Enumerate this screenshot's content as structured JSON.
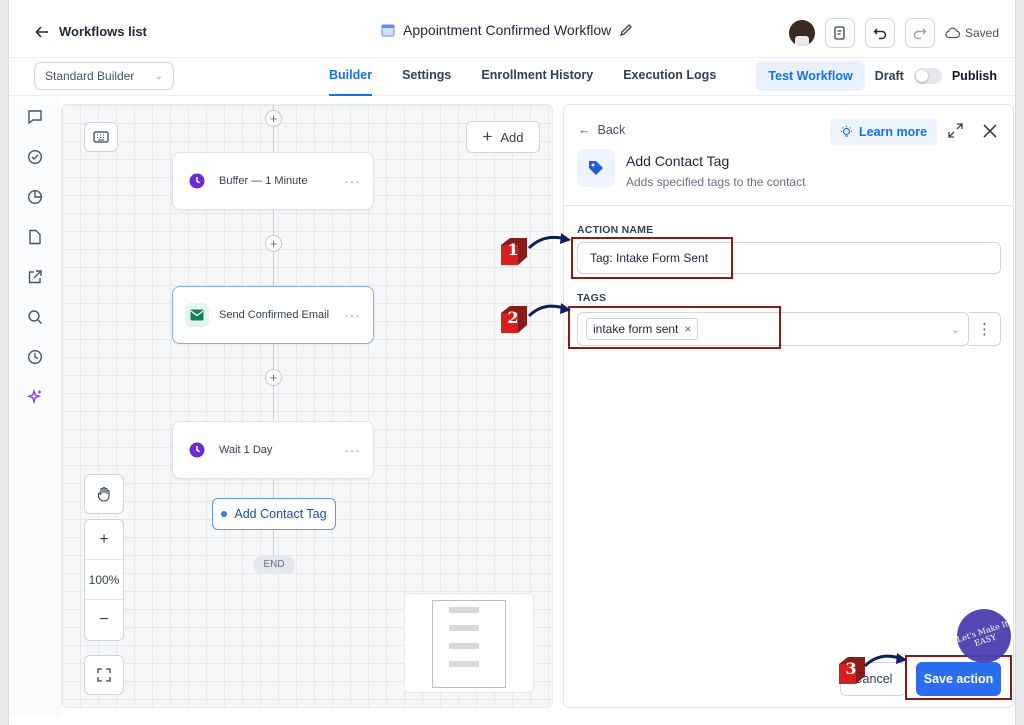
{
  "header": {
    "back_label": "Workflows list",
    "workflow_title": "Appointment Confirmed Workflow",
    "saved_label": "Saved"
  },
  "subbar": {
    "builder_select": "Standard Builder",
    "tabs": [
      {
        "label": "Builder",
        "active": true
      },
      {
        "label": "Settings",
        "active": false
      },
      {
        "label": "Enrollment History",
        "active": false
      },
      {
        "label": "Execution Logs",
        "active": false
      }
    ],
    "test_button": "Test Workflow",
    "draft_label": "Draft",
    "publish_label": "Publish"
  },
  "sidebar": {
    "icons": [
      "chat-icon",
      "check-circle-icon",
      "pie-chart-icon",
      "file-icon",
      "external-link-icon",
      "search-icon",
      "clock-icon",
      "sparkles-icon"
    ]
  },
  "canvas": {
    "add_button": "Add",
    "nodes": [
      {
        "label": "Buffer — 1 Minute",
        "icon": "clock-icon",
        "color": "#7c3aed"
      },
      {
        "label": "Send Confirmed Email",
        "icon": "mail-icon",
        "color": "#12805c"
      },
      {
        "label": "Wait 1 Day",
        "icon": "clock-icon",
        "color": "#7c3aed"
      }
    ],
    "new_action_label": "Add Contact Tag",
    "end_label": "END",
    "zoom_level": "100%"
  },
  "panel": {
    "back_label": "Back",
    "learn_more": "Learn more",
    "title": "Add Contact Tag",
    "description": "Adds specified tags to the contact",
    "action_name_label": "ACTION NAME",
    "action_name_value": "Tag: Intake Form Sent",
    "tags_label": "TAGS",
    "tag_chip": "intake form sent",
    "cancel_label": "Cancel",
    "save_label": "Save action"
  },
  "annotations": {
    "step1": "1",
    "step2": "2",
    "step3": "3",
    "watermark": "Let's Make It EASY",
    "accent": "#8b1a1a"
  }
}
